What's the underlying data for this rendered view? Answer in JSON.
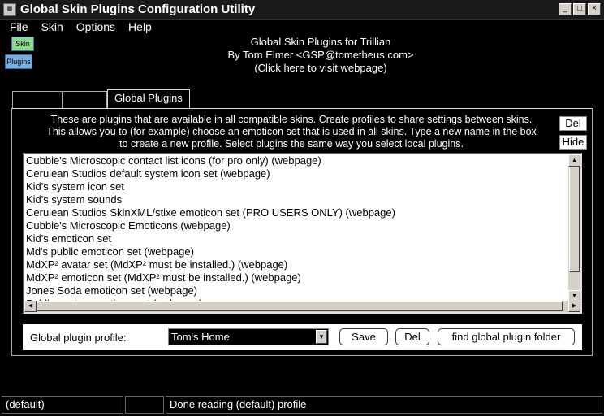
{
  "window": {
    "title": "Global Skin Plugins Configuration Utility",
    "icon": "skin-app-icon",
    "minimize": "_",
    "maximize": "□",
    "close": "×"
  },
  "menu": [
    "File",
    "Skin",
    "Options",
    "Help"
  ],
  "logo": {
    "top": "Skin",
    "bottom": "Plugins"
  },
  "header": {
    "line1": "Global Skin Plugins for Trillian",
    "line2": "By Tom Elmer <GSP@tometheus.com>",
    "line3": "(Click here to visit webpage)"
  },
  "tabs": [
    "",
    "",
    "Global Plugins"
  ],
  "description": {
    "line1": "These are plugins that are available in all compatible skins.  Create profiles to share settings between skins.",
    "line2": "This allows you to (for example) choose an emoticon set that is used in all skins.  Type a new name in the box",
    "line3": "to create a new profile.  Select plugins the same way you select local plugins."
  },
  "side_buttons": {
    "del": "Del",
    "hide": "Hide"
  },
  "plugins": [
    "Cubbie's Microscopic contact list icons (for pro only) (webpage)",
    "Cerulean Studios default system icon set (webpage)",
    "Kid's system icon set",
    "Kid's system sounds",
    "Cerulean Studios SkinXML/stixe emoticon set (PRO USERS ONLY) (webpage)",
    "Cubbie's Microscopic Emoticons (webpage)",
    "Kid's emoticon set",
    "Md's public emoticon set (webpage)",
    "MdXP² avatar set (MdXP² must be installed.) (webpage)",
    "MdXP² emoticon set (MdXP² must be installed.) (webpage)",
    "Jones Soda emoticon set (webpage)",
    "Public avatar emoticon set (webpage)"
  ],
  "profile": {
    "label": "Global plugin profile:",
    "value": "Tom's Home",
    "save": "Save",
    "del": "Del",
    "find": "find global plugin folder"
  },
  "status": {
    "profile": "(default)",
    "middle": "",
    "message": "Done reading (default) profile"
  }
}
